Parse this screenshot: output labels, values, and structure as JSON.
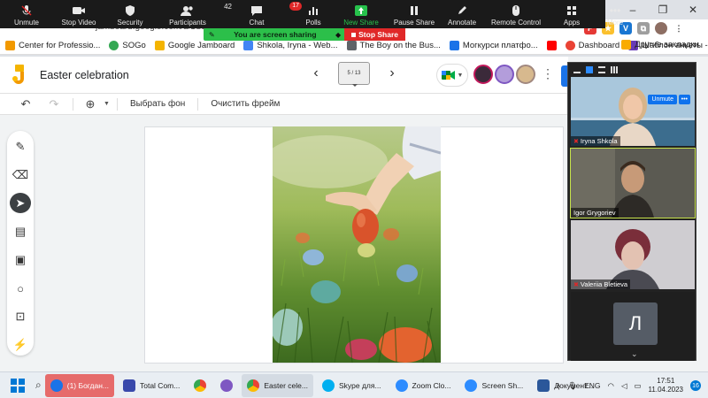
{
  "zoom_toolbar": {
    "unmute": "Unmute",
    "stop_video": "Stop Video",
    "security": "Security",
    "participants": "Participants",
    "participants_count": "42",
    "chat": "Chat",
    "chat_badge": "17",
    "polls": "Polls",
    "new_share": "New Share",
    "pause_share": "Pause Share",
    "annotate": "Annotate",
    "remote_control": "Remote Control",
    "apps": "Apps",
    "more": "More"
  },
  "share_banner": {
    "text": "You are screen sharing",
    "stop_label": "Stop Share"
  },
  "browser": {
    "url": "jamboard.google.com/d/1SJPg...",
    "bookmarks": [
      {
        "label": "Center for Professio...",
        "color": "#f29900"
      },
      {
        "label": "SOGo",
        "color": "#34a853"
      },
      {
        "label": "Google Jamboard",
        "color": "#f4b400"
      },
      {
        "label": "Shkola, Iryna - Web...",
        "color": "#4285f4"
      },
      {
        "label": "The Boy on the Bus...",
        "color": "#5f6368"
      },
      {
        "label": "Могкурси платфо...",
        "color": "#1a73e8"
      },
      {
        "label": "",
        "color": "#ff0000"
      },
      {
        "label": "Dashboard",
        "color": "#ea4335"
      },
      {
        "label": "Шаблон анкеты - ...",
        "color": "#673ab7"
      }
    ],
    "other_bookmarks": "Другие закладки"
  },
  "jamboard": {
    "title": "Easter celebration",
    "frame_indicator": "5 / 13",
    "set_background": "Выбрать фон",
    "clear_frame": "Очистить фрейм"
  },
  "participants": [
    {
      "name": "Iryna Shkola",
      "muted": true
    },
    {
      "name": "Igor Grygoriev",
      "muted": false
    },
    {
      "name": "Valeriia Bletieva",
      "muted": true
    },
    {
      "name": "Анна Лопатюк",
      "muted": true,
      "initial": "Л"
    }
  ],
  "panel": {
    "unmute_label": "Unmute",
    "more_label": "•••"
  },
  "taskbar": {
    "items": [
      {
        "label": "(1) Богдан...",
        "color": "#1a73e8"
      },
      {
        "label": "Total Com...",
        "color": "#3949ab"
      },
      {
        "label": "",
        "color": "#ea4335"
      },
      {
        "label": "",
        "color": "#7e57c2"
      },
      {
        "label": "Easter cele...",
        "color": "#fbbc04"
      },
      {
        "label": "Skype для...",
        "color": "#00aff0"
      },
      {
        "label": "Zoom Clo...",
        "color": "#2d8cff"
      },
      {
        "label": "Screen Sh...",
        "color": "#2d8cff"
      },
      {
        "label": "Документ...",
        "color": "#2b579a"
      }
    ],
    "lang": "ENG",
    "time": "17:51",
    "date": "11.04.2023",
    "notifications": "16"
  }
}
